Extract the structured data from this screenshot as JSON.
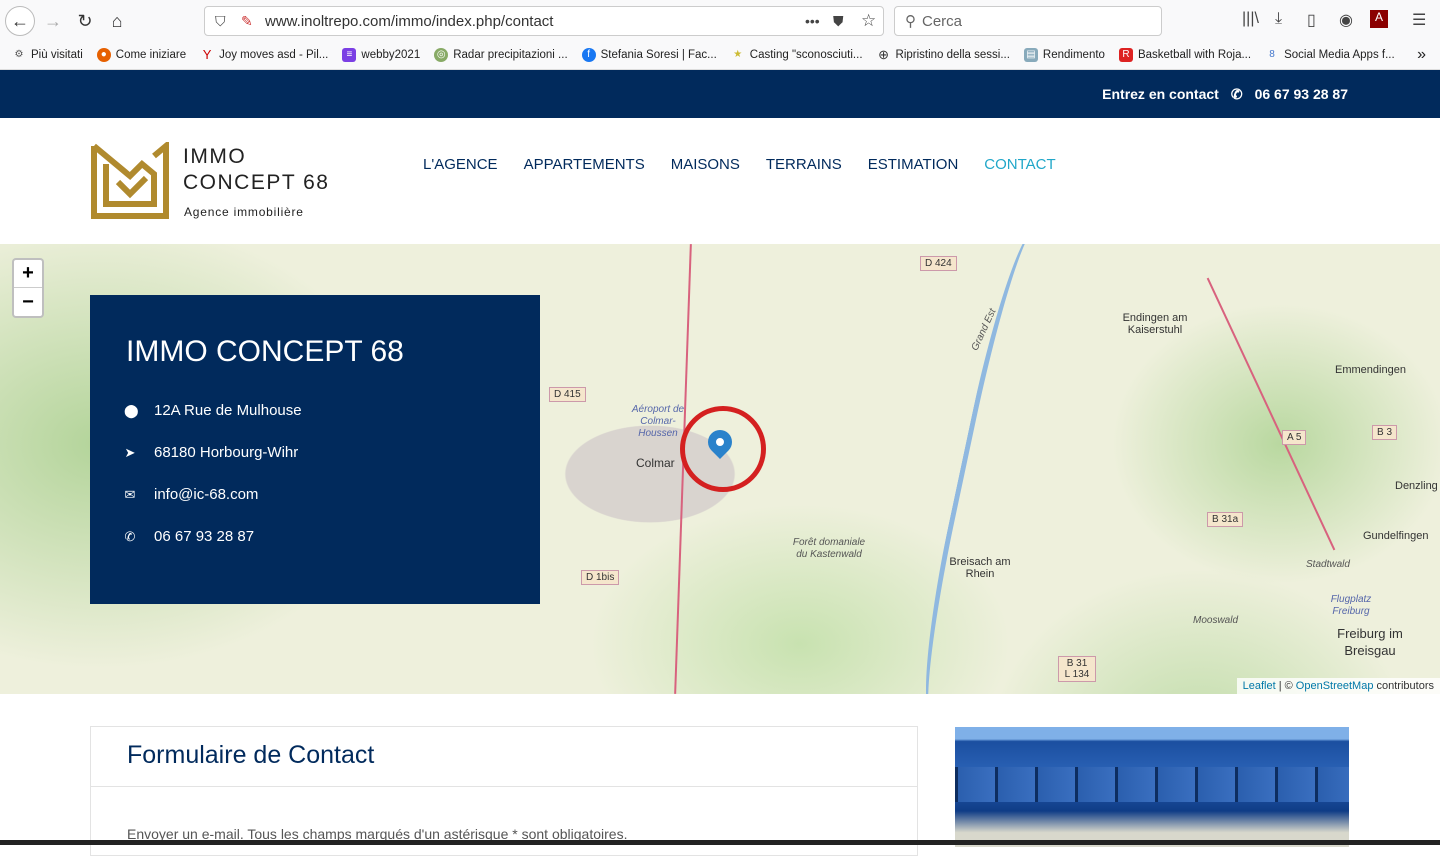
{
  "browser": {
    "url": "www.inoltrepo.com/immo/index.php/contact",
    "search_placeholder": "Cerca",
    "bookmarks": [
      "Più visitati",
      "Come iniziare",
      "Joy moves asd - Pil...",
      "webby2021",
      "Radar precipitazioni ...",
      "Stefania Soresi | Fac...",
      "Casting \"sconosciuti...",
      "Ripristino della sessi...",
      "Rendimento",
      "Basketball with Roja...",
      "Social Media Apps f..."
    ]
  },
  "topbar": {
    "contact_label": "Entrez en contact",
    "phone": "06 67 93 28 87"
  },
  "logo": {
    "line1": "IMMO",
    "line2": "CONCEPT 68",
    "tagline": "Agence immobilière",
    "color": "#b08a2e"
  },
  "nav": [
    "L'AGENCE",
    "APPARTEMENTS",
    "MAISONS",
    "TERRAINS",
    "ESTIMATION",
    "CONTACT"
  ],
  "card": {
    "title": "IMMO CONCEPT 68",
    "address": "12A Rue de Mulhouse",
    "city": "68180 Horbourg-Wihr",
    "email": "info@ic-68.com",
    "phone": "06 67 93 28 87"
  },
  "map": {
    "zoom_in": "+",
    "zoom_out": "−",
    "labels": {
      "colmar": "Colmar",
      "aeroport": "Aéroport de Colmar-Houssen",
      "endingen": "Endingen am Kaiserstuhl",
      "emmendingen": "Emmendingen",
      "denzling": "Denzling",
      "gundelfingen": "Gundelfingen",
      "breisach": "Breisach am Rhein",
      "foret": "Forêt domaniale du Kastenwald",
      "freiburg": "Freiburg im Breisgau",
      "stadtwald": "Stadtwald",
      "flugplatz": "Flugplatz Freiburg",
      "mooswald": "Mooswald",
      "grandest": "Grand Est"
    },
    "shields": {
      "d424": "D 424",
      "d415": "D 415",
      "d1bis": "D 1bis",
      "a5": "A 5",
      "b3": "B 3",
      "b31a": "B 31a",
      "b31": "B 31 L 134"
    },
    "attribution": {
      "leaflet": "Leaflet",
      "sep": "| ©",
      "osm": "OpenStreetMap",
      "contributors": "contributors"
    }
  },
  "form": {
    "title": "Formulaire de Contact",
    "intro": "Envoyer un e-mail. Tous les champs marqués d'un astérisque * sont obligatoires."
  }
}
